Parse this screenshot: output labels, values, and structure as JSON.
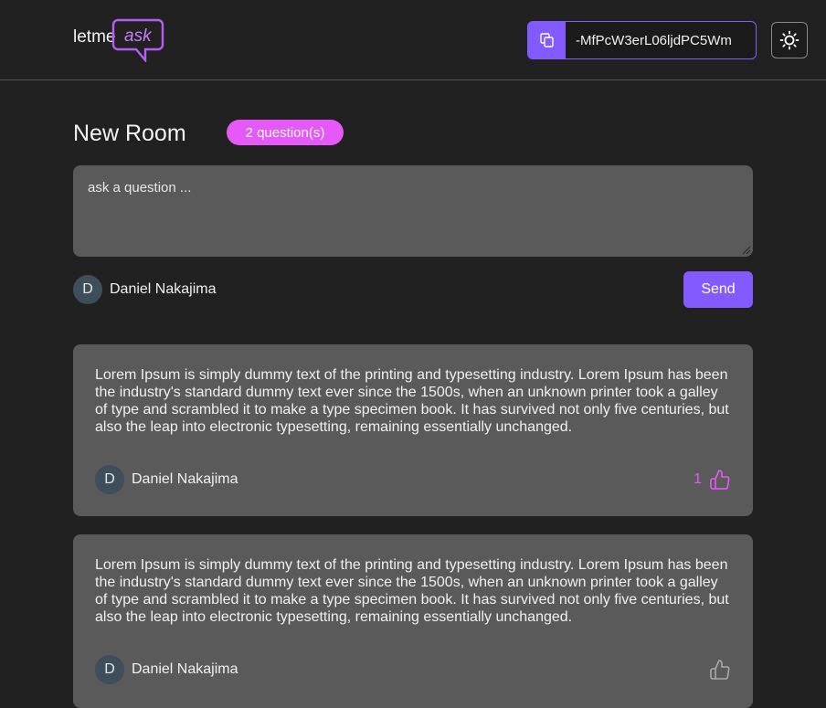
{
  "header": {
    "logo_text": "letmeask",
    "room_code": "-MfPcW3erL06ljdPC5Wm",
    "accent": "#835afd"
  },
  "room": {
    "title": "New Room",
    "question_count": "2 question(s)"
  },
  "form": {
    "placeholder": "ask a question ...",
    "author_initial": "D",
    "author_name": "Daniel Nakajima",
    "send_label": "Send"
  },
  "questions": [
    {
      "text": "Lorem Ipsum is simply dummy text of the printing and typesetting industry. Lorem Ipsum has been the industry's standard dummy text ever since the 1500s, when an unknown printer took a galley of type and scrambled it to make a type specimen book. It has survived not only five centuries, but also the leap into electronic typesetting, remaining essentially unchanged.",
      "author_initial": "D",
      "author_name": "Daniel Nakajima",
      "likes": "1"
    },
    {
      "text": "Lorem Ipsum is simply dummy text of the printing and typesetting industry. Lorem Ipsum has been the industry's standard dummy text ever since the 1500s, when an unknown printer took a galley of type and scrambled it to make a type specimen book. It has survived not only five centuries, but also the leap into electronic typesetting, remaining essentially unchanged.",
      "author_initial": "D",
      "author_name": "Daniel Nakajima",
      "likes": ""
    }
  ]
}
